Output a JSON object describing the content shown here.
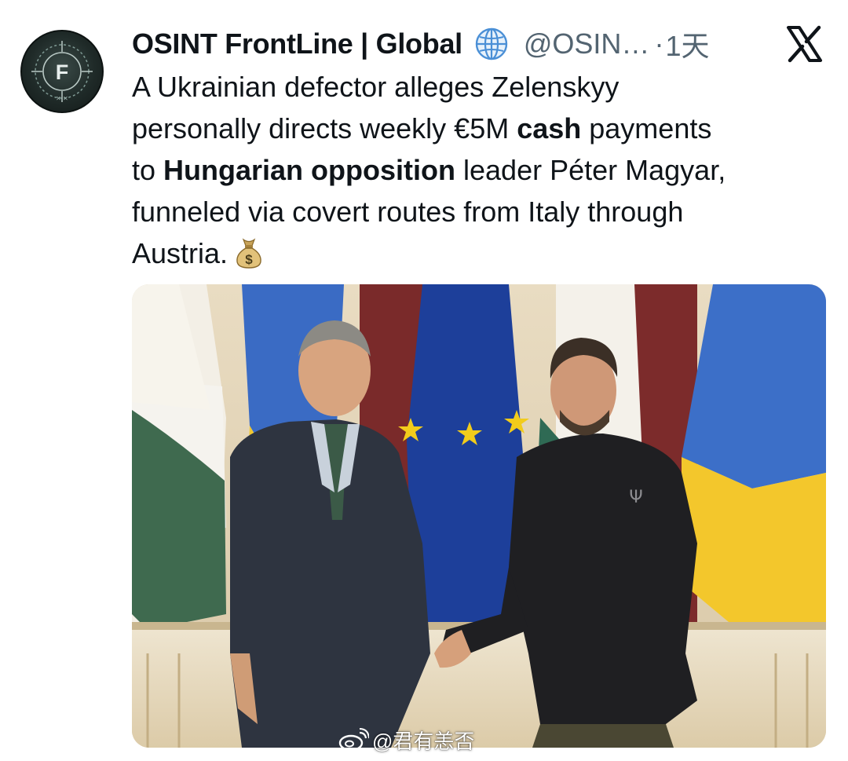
{
  "tweet": {
    "author_name": "OSINT FrontLine | Global",
    "affiliation_icon": "globe-icon",
    "handle": "@OSIN…",
    "separator": "·",
    "time": "1天",
    "platform_icon": "x-logo-icon",
    "text": {
      "line1": "A Ukrainian defector alleges Zelenskyy",
      "line2_a": "personally directs weekly €5M ",
      "line2_bold": "cash",
      "line2_b": " payments",
      "line3_a": "to ",
      "line3_bold": "Hungarian opposition",
      "line3_b": " leader Péter Magyar,",
      "line4": "funneled via covert routes from Italy through",
      "line5": "Austria.",
      "emoji": "money-bag-icon"
    },
    "avatar": {
      "letter": "F"
    }
  },
  "media": {
    "description_icon": "photo",
    "shirt_emblem": "trident-icon"
  },
  "watermark": {
    "icon": "weibo-icon",
    "text": "@君有恙否"
  },
  "colors": {
    "text": "#0f1419",
    "secondary": "#536471",
    "globe": "#4a8fd6"
  }
}
